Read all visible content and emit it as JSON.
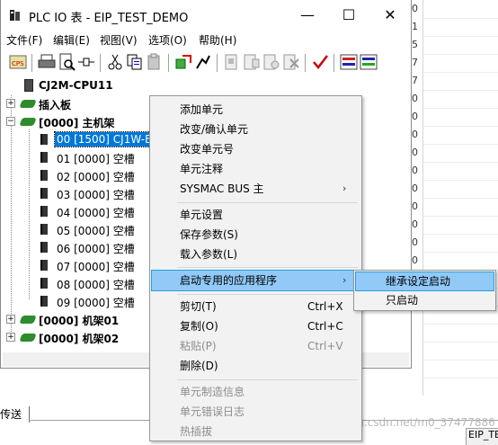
{
  "window": {
    "title": "PLC IO 表 - EIP_TEST_DEMO",
    "minimize_glyph": "—",
    "maximize_glyph": "☐",
    "close_glyph": "✕"
  },
  "menubar": [
    "文件(F)",
    "编辑(E)",
    "视图(V)",
    "选项(O)",
    "帮助(H)"
  ],
  "toolbar_icons": [
    "cps-icon",
    "print-icon",
    "print-preview-icon",
    "connect-icon",
    "cut-icon",
    "copy-icon",
    "paste-icon",
    "transfer-icon",
    "online-icon",
    "unit-setting-icon",
    "unit-param-icon",
    "unit-param2-icon",
    "unit-delete-icon",
    "check-icon",
    "compare-icon",
    "verify-icon"
  ],
  "tree": {
    "cpu": "CJ2M-CPU11",
    "plugin_board": "插入板",
    "main_rack": "[0000] 主机架",
    "slots": [
      "00 [1500] CJ1W-E",
      "01 [0000] 空槽",
      "02 [0000] 空槽",
      "03 [0000] 空槽",
      "04 [0000] 空槽",
      "05 [0000] 空槽",
      "06 [0000] 空槽",
      "07 [0000] 空槽",
      "08 [0000] 空槽",
      "09 [0000] 空槽"
    ],
    "rack01": "[0000] 机架01",
    "rack02": "[0000] 机架02"
  },
  "background": {
    "column_digits": [
      "0",
      "1",
      "5",
      "7",
      "7",
      "0",
      "0",
      "0",
      "0",
      "0",
      "0",
      "0",
      "0",
      "0",
      "0"
    ],
    "bottom_tab": "传送",
    "status_cell": "EIP_TE",
    "watermark": "https://blog.csdn.net/m0_37477886"
  },
  "context_menu": {
    "items": [
      {
        "label": "添加单元",
        "shortcut": "",
        "submenu": false,
        "disabled": false
      },
      {
        "label": "改变/确认单元",
        "shortcut": "",
        "submenu": false,
        "disabled": false
      },
      {
        "label": "改变单元号",
        "shortcut": "",
        "submenu": false,
        "disabled": false
      },
      {
        "label": "单元注释",
        "shortcut": "",
        "submenu": false,
        "disabled": false
      },
      {
        "label": "SYSMAC BUS 主",
        "shortcut": "",
        "submenu": true,
        "disabled": false
      },
      {
        "label": "单元设置",
        "shortcut": "",
        "submenu": false,
        "disabled": false
      },
      {
        "label": "保存参数(S)",
        "shortcut": "",
        "submenu": false,
        "disabled": false
      },
      {
        "label": "载入参数(L)",
        "shortcut": "",
        "submenu": false,
        "disabled": false
      },
      {
        "label": "启动专用的应用程序",
        "shortcut": "",
        "submenu": true,
        "disabled": false
      },
      {
        "label": "剪切(T)",
        "shortcut": "Ctrl+X",
        "submenu": false,
        "disabled": false
      },
      {
        "label": "复制(O)",
        "shortcut": "Ctrl+C",
        "submenu": false,
        "disabled": false
      },
      {
        "label": "粘贴(P)",
        "shortcut": "Ctrl+V",
        "submenu": false,
        "disabled": true
      },
      {
        "label": "删除(D)",
        "shortcut": "",
        "submenu": false,
        "disabled": false
      },
      {
        "label": "单元制造信息",
        "shortcut": "",
        "submenu": false,
        "disabled": true
      },
      {
        "label": "单元错误日志",
        "shortcut": "",
        "submenu": false,
        "disabled": true
      },
      {
        "label": "热插拔",
        "shortcut": "",
        "submenu": false,
        "disabled": true
      }
    ],
    "arrow_glyph": "›"
  },
  "submenu": {
    "items": [
      "继承设定启动",
      "只启动"
    ]
  }
}
